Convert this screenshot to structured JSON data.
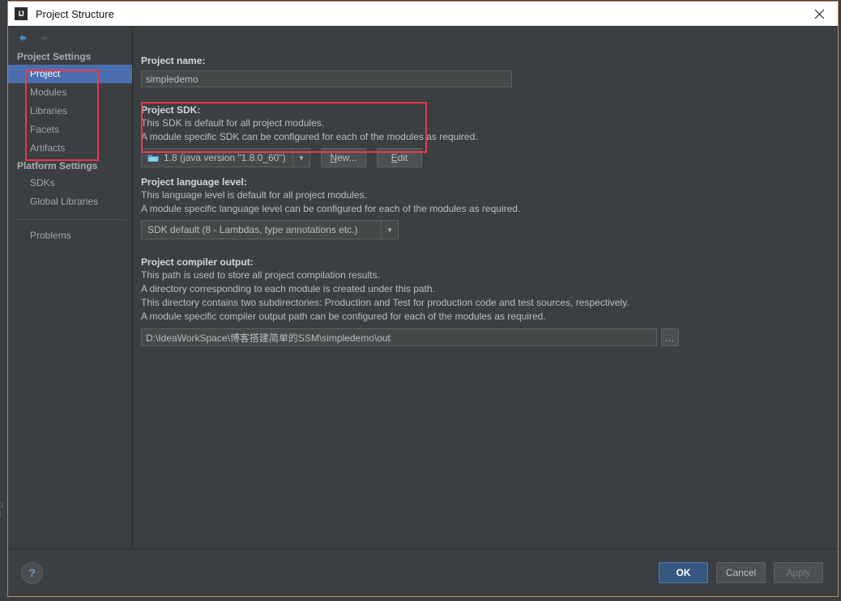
{
  "window": {
    "title": "Project Structure",
    "logo_icon": "intellij-idea-logo-icon",
    "close_icon": "close-icon"
  },
  "sidebar": {
    "nav": {
      "back_icon": "back-arrow-icon",
      "forward_icon": "forward-arrow-icon"
    },
    "groups": [
      {
        "title": "Project Settings",
        "items": [
          {
            "label": "Project",
            "selected": true
          },
          {
            "label": "Modules",
            "selected": false
          },
          {
            "label": "Libraries",
            "selected": false
          },
          {
            "label": "Facets",
            "selected": false
          },
          {
            "label": "Artifacts",
            "selected": false
          }
        ]
      },
      {
        "title": "Platform Settings",
        "items": [
          {
            "label": "SDKs",
            "selected": false
          },
          {
            "label": "Global Libraries",
            "selected": false
          }
        ]
      }
    ],
    "problems_label": "Problems"
  },
  "main": {
    "project_name": {
      "label": "Project name:",
      "value": "simpledemo",
      "placeholder": "Project name"
    },
    "project_sdk": {
      "label": "Project SDK:",
      "desc_1": "This SDK is default for all project modules.",
      "desc_2": "A module specific SDK can be configured for each of the modules as required.",
      "selected": "1.8 (java version \"1.8.0_60\")",
      "sdk_name": "1.8",
      "sdk_version": "(java version \"1.8.0_60\")",
      "icon": "sdk-folder-icon",
      "dropdown_icon": "chevron-down-icon",
      "new_button": "New...",
      "new_button_mnemonic": "N",
      "edit_button": "Edit",
      "edit_button_mnemonic": "E"
    },
    "language_level": {
      "label": "Project language level:",
      "desc_1": "This language level is default for all project modules.",
      "desc_2": "A module specific language level can be configured for each of the modules as required.",
      "selected": "SDK default (8 - Lambdas, type annotations etc.)",
      "dropdown_icon": "chevron-down-icon"
    },
    "compiler_output": {
      "label": "Project compiler output:",
      "desc_1": "This path is used to store all project compilation results.",
      "desc_2": "A directory corresponding to each module is created under this path.",
      "desc_3": "This directory contains two subdirectories: Production and Test for production code and test sources, respectively.",
      "desc_4": "A module specific compiler output path can be configured for each of the modules as required.",
      "value": "D:\\IdeaWorkSpace\\博客搭建简单的SSM\\simpledemo\\out",
      "placeholder": "Compiler output path",
      "browse_button": "...",
      "browse_icon": "browse-ellipsis-icon"
    }
  },
  "footer": {
    "help_label": "?",
    "help_icon": "help-question-icon",
    "ok_label": "OK",
    "cancel_label": "Cancel",
    "apply_label": "Apply",
    "apply_disabled": true
  },
  "annotations": {
    "color": "#e8384f",
    "boxes": [
      "project-settings-nav-group",
      "project-sdk-row"
    ]
  },
  "colors": {
    "dialog_bg": "#3c3f41",
    "field_bg": "#45494a",
    "selection_blue": "#4b6eaf",
    "primary_button": "#365880",
    "window_border": "#c2855a",
    "annotation_red": "#e8384f"
  }
}
